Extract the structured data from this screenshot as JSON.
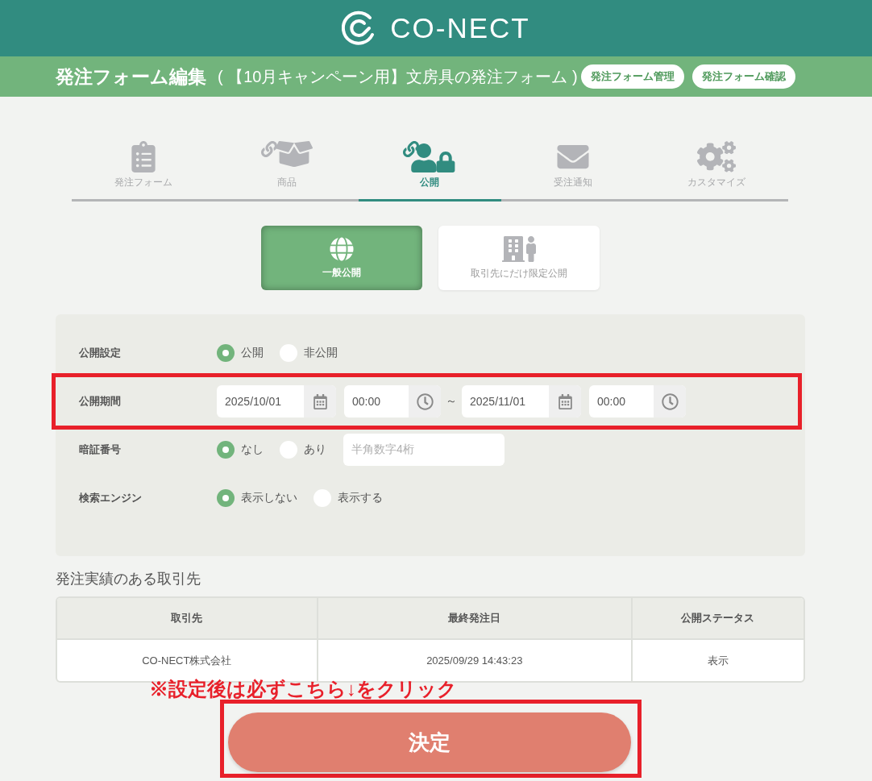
{
  "header": {
    "logo_text": "CO-NECT"
  },
  "title_bar": {
    "title": "発注フォーム編集",
    "subtitle": "( 【10月キャンペーン用】文房具の発注フォーム )",
    "buttons": [
      "発注フォーム管理",
      "発注フォーム確認"
    ]
  },
  "tabs": [
    {
      "label": "発注フォーム",
      "selected": false
    },
    {
      "label": "商品",
      "selected": false
    },
    {
      "label": "公開",
      "selected": true
    },
    {
      "label": "受注通知",
      "selected": false
    },
    {
      "label": "カスタマイズ",
      "selected": false
    }
  ],
  "visibility_options": [
    {
      "label": "一般公開",
      "selected": true
    },
    {
      "label": "取引先にだけ限定公開",
      "selected": false
    }
  ],
  "settings": {
    "rows": [
      {
        "label": "公開設定",
        "kind": "radio",
        "highlighted": false,
        "options": [
          {
            "label": "公開",
            "selected": true
          },
          {
            "label": "非公開",
            "selected": false
          }
        ]
      },
      {
        "label": "公開期間",
        "kind": "period",
        "highlighted": true,
        "start_date": "2025/10/01",
        "start_time": "00:00",
        "separator": "～",
        "end_date": "2025/11/01",
        "end_time": "00:00"
      },
      {
        "label": "暗証番号",
        "kind": "radio",
        "highlighted": false,
        "options": [
          {
            "label": "なし",
            "selected": true
          },
          {
            "label": "あり",
            "selected": false
          }
        ],
        "input": {
          "placeholder": "半角数字4桁"
        }
      },
      {
        "label": "検索エンジン",
        "kind": "radio",
        "highlighted": false,
        "options": [
          {
            "label": "表示しない",
            "selected": true
          },
          {
            "label": "表示する",
            "selected": false
          }
        ]
      }
    ]
  },
  "partners": {
    "title": "発注実績のある取引先",
    "columns": [
      "取引先",
      "最終発注日",
      "公開ステータス"
    ],
    "rows": [
      [
        "CO-NECT株式会社",
        "2025/09/29 14:43:23",
        "表示"
      ]
    ]
  },
  "note": "※設定後は必ずこちら↓をクリック",
  "submit": {
    "label": "決定",
    "highlighted": true
  }
}
